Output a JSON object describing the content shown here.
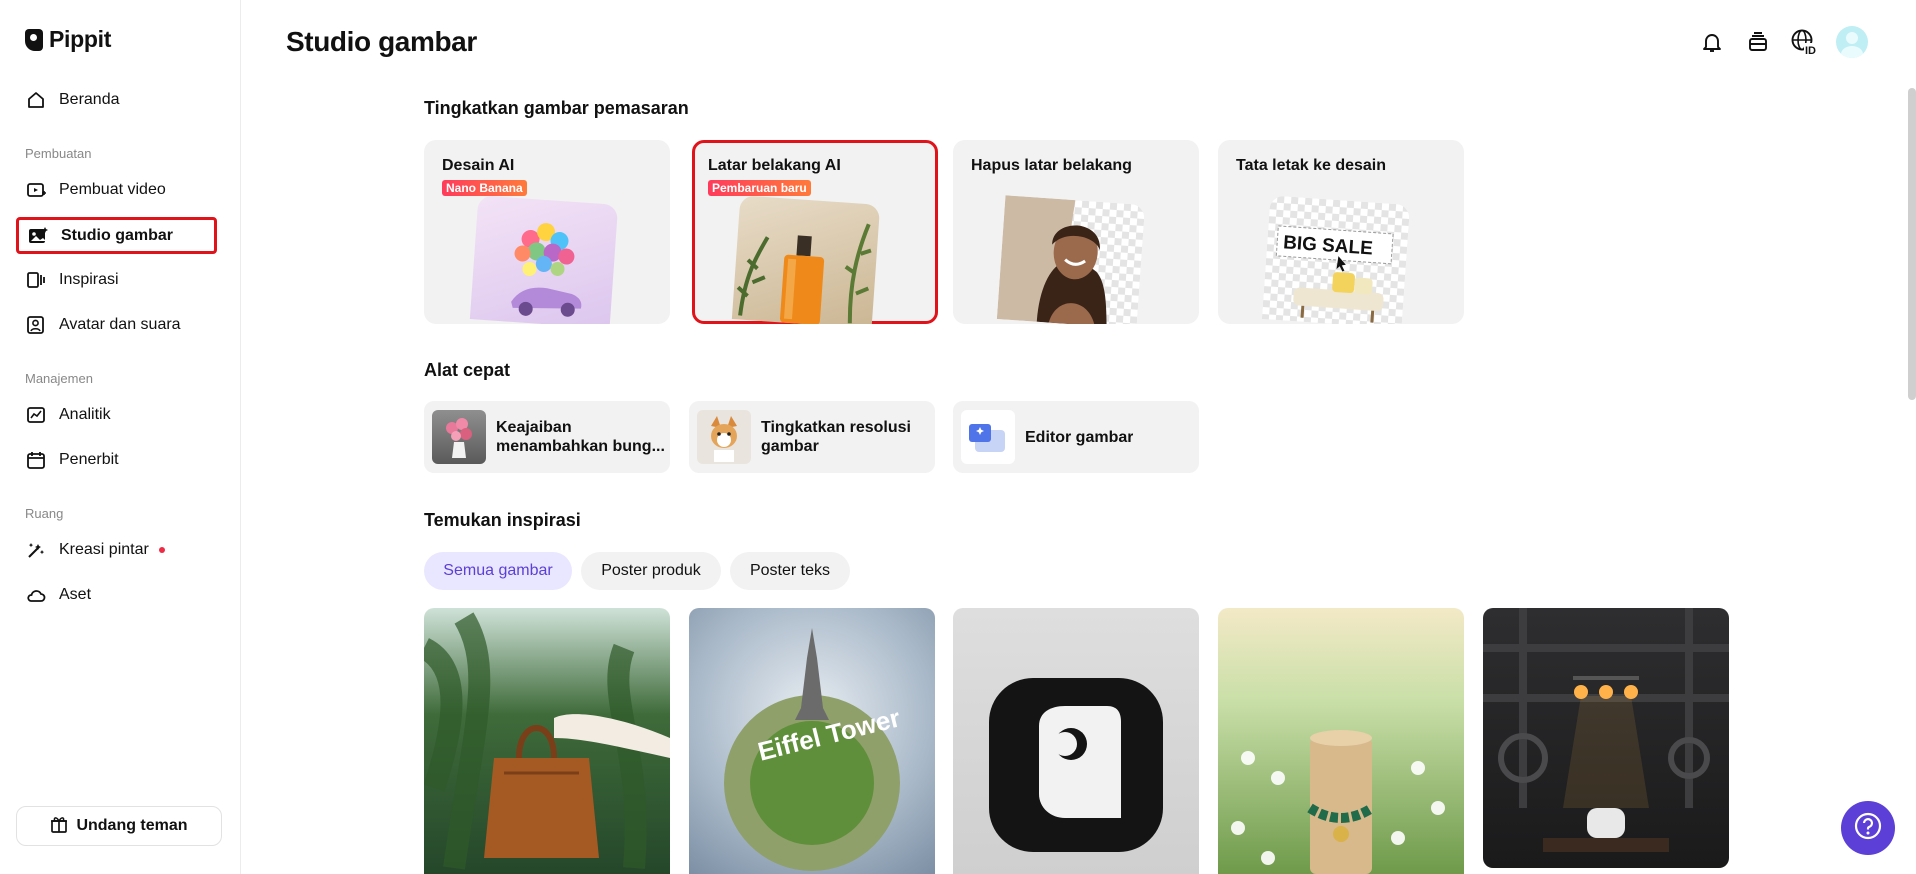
{
  "app": {
    "name": "Pippit"
  },
  "sidebar": {
    "home": "Beranda",
    "section_creation": "Pembuatan",
    "video_maker": "Pembuat video",
    "image_studio": "Studio gambar",
    "inspiration": "Inspirasi",
    "avatar_voice": "Avatar dan suara",
    "section_management": "Manajemen",
    "analytics": "Analitik",
    "publisher": "Penerbit",
    "section_space": "Ruang",
    "smart_creation": "Kreasi pintar",
    "assets": "Aset",
    "invite": "Undang teman"
  },
  "header": {
    "title": "Studio gambar",
    "icons": [
      "bell-icon",
      "stack-icon",
      "globe-id-icon",
      "avatar"
    ]
  },
  "enhance": {
    "heading": "Tingkatkan gambar pemasaran",
    "cards": [
      {
        "title": "Desain AI",
        "badge": "Nano Banana"
      },
      {
        "title": "Latar belakang AI",
        "badge": "Pembaruan baru"
      },
      {
        "title": "Hapus latar belakang",
        "badge": ""
      },
      {
        "title": "Tata letak ke desain",
        "badge": ""
      }
    ],
    "sale_text": "BIG SALE"
  },
  "quick_tools": {
    "heading": "Alat cepat",
    "items": [
      {
        "label": "Keajaiban menambahkan bung..."
      },
      {
        "label": "Tingkatkan resolusi gambar"
      },
      {
        "label": "Editor gambar"
      }
    ]
  },
  "inspiration": {
    "heading": "Temukan inspirasi",
    "filters": [
      "Semua gambar",
      "Poster produk",
      "Poster teks"
    ],
    "active_filter": "Semua gambar",
    "tile_text": "Eiffel Tower"
  },
  "colors": {
    "accent": "#5b3fd6",
    "highlight": "#e0121a",
    "badge_from": "#ff3b5c",
    "badge_to": "#ff7a3a"
  }
}
